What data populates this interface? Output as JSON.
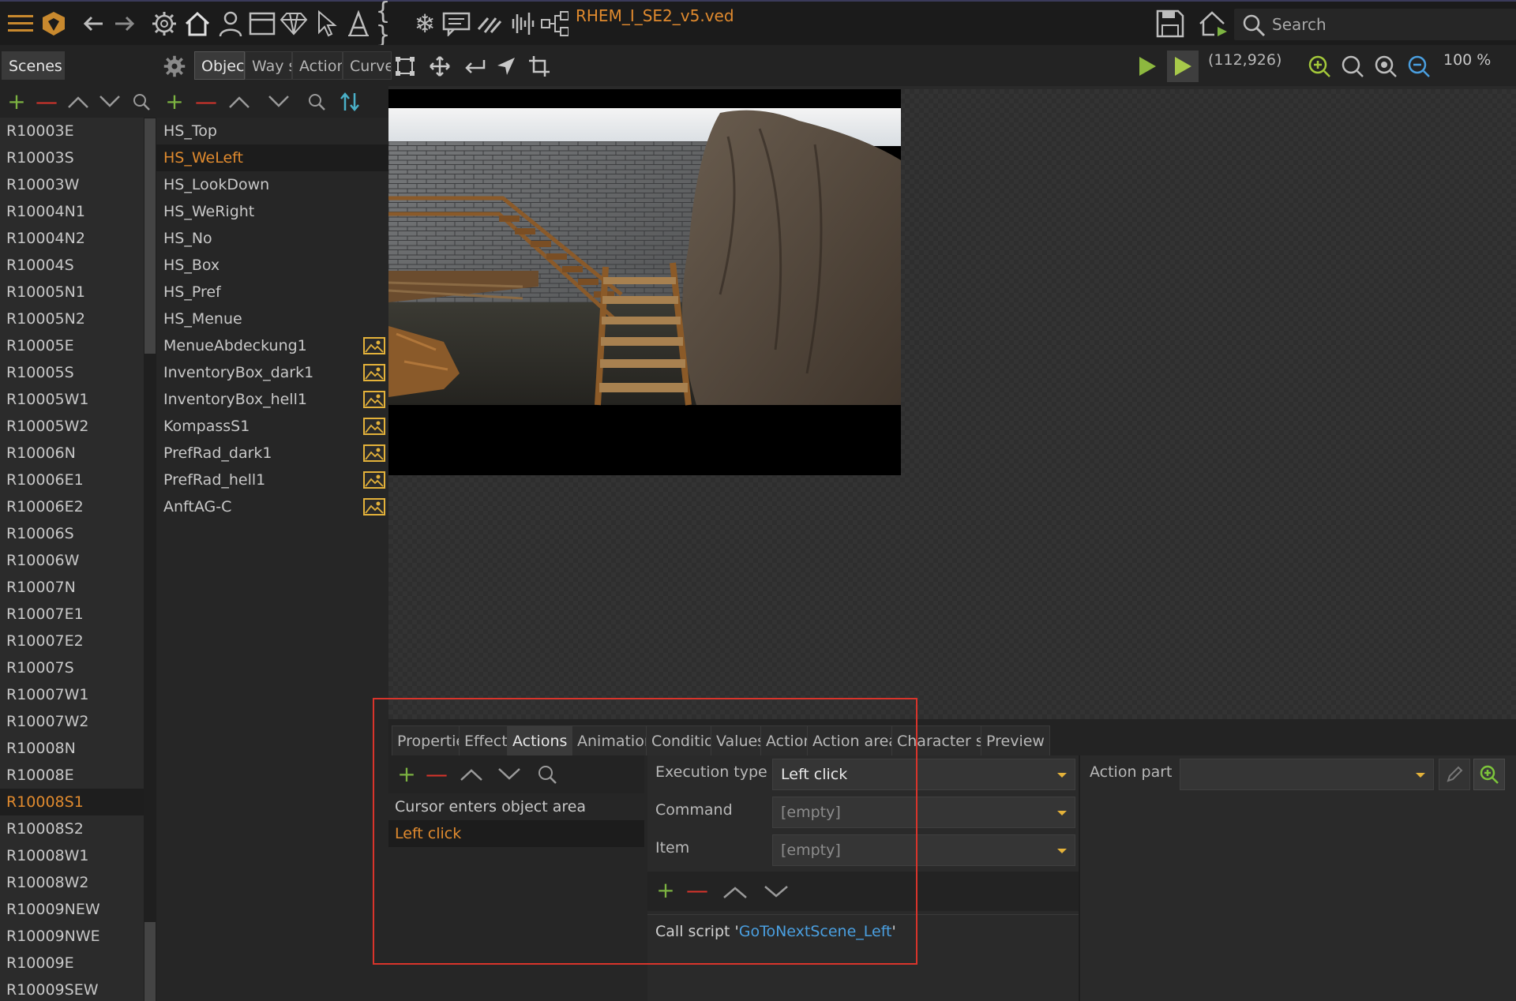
{
  "app": {
    "title": "RHEM_I_SE2_v5.ved"
  },
  "search": {
    "placeholder": "Search"
  },
  "tabs": {
    "scenes": "Scenes",
    "object": "Object",
    "way": "Way sy",
    "action": "Action",
    "curves": "Curves"
  },
  "status": {
    "coords": "(112,926)",
    "zoom": "100 %"
  },
  "icons": {
    "topbar": [
      "menu-icon",
      "logo-icon",
      "back-icon",
      "forward-icon",
      "gear-icon",
      "home-icon",
      "user-icon",
      "window-icon",
      "diamond-icon",
      "cursor-icon",
      "text-icon",
      "braces-icon",
      "snowflake-icon",
      "comment-icon",
      "stripes-icon",
      "audio-icon",
      "tree-icon",
      "save-icon",
      "home-play-icon",
      "search-icon"
    ],
    "canvas_tools": [
      "select-rect-icon",
      "move-icon",
      "return-icon",
      "navigate-icon",
      "crop-icon"
    ],
    "view": [
      "play-icon",
      "play-box-icon",
      "zoom-in-icon",
      "zoom-fit-icon",
      "zoom-target-icon",
      "zoom-out-icon"
    ]
  },
  "scenes": [
    "R10003E",
    "R10003S",
    "R10003W",
    "R10004N1",
    "R10004N2",
    "R10004S",
    "R10005N1",
    "R10005N2",
    "R10005E",
    "R10005S",
    "R10005W1",
    "R10005W2",
    "R10006N",
    "R10006E1",
    "R10006E2",
    "R10006S",
    "R10006W",
    "R10007N",
    "R10007E1",
    "R10007E2",
    "R10007S",
    "R10007W1",
    "R10007W2",
    "R10008N",
    "R10008E",
    "R10008S1",
    "R10008S2",
    "R10008W1",
    "R10008W2",
    "R10009NEW",
    "R10009NWE",
    "R10009E",
    "R10009SEW"
  ],
  "scenes_selected": "R10008S1",
  "objects": [
    {
      "label": "HS_Top",
      "image": false
    },
    {
      "label": "HS_WeLeft",
      "image": false,
      "selected": true
    },
    {
      "label": "HS_LookDown",
      "image": false
    },
    {
      "label": "HS_WeRight",
      "image": false
    },
    {
      "label": "HS_No",
      "image": false
    },
    {
      "label": "HS_Box",
      "image": false
    },
    {
      "label": "HS_Pref",
      "image": false
    },
    {
      "label": "HS_Menue",
      "image": false
    },
    {
      "label": "MenueAbdeckung1",
      "image": true
    },
    {
      "label": "InventoryBox_dark1",
      "image": true
    },
    {
      "label": "InventoryBox_hell1",
      "image": true
    },
    {
      "label": "KompassS1",
      "image": true
    },
    {
      "label": "PrefRad_dark1",
      "image": true
    },
    {
      "label": "PrefRad_hell1",
      "image": true
    },
    {
      "label": "AnftAG-C",
      "image": true
    }
  ],
  "bottom_tabs": [
    "Properties",
    "Effects",
    "Actions",
    "Animations",
    "Conditions",
    "Values",
    "Action",
    "Action areas",
    "Character size",
    "Preview"
  ],
  "bottom_active": "Actions",
  "actions_list": [
    {
      "label": "Cursor enters object area"
    },
    {
      "label": "Left click",
      "selected": true
    }
  ],
  "detail": {
    "execution_type_label": "Execution type",
    "execution_type_value": "Left click",
    "command_label": "Command",
    "command_value": "[empty]",
    "item_label": "Item",
    "item_value": "[empty]",
    "call_prefix": "Call script '",
    "call_script": "GoToNextScene_Left",
    "call_suffix": "'"
  },
  "action_part": {
    "label": "Action part",
    "value": ""
  },
  "colors": {
    "accent": "#e08a2e",
    "add": "#7cb341",
    "remove": "#d9342b",
    "link": "#4a9fe0",
    "highlight": "#d9342b"
  }
}
